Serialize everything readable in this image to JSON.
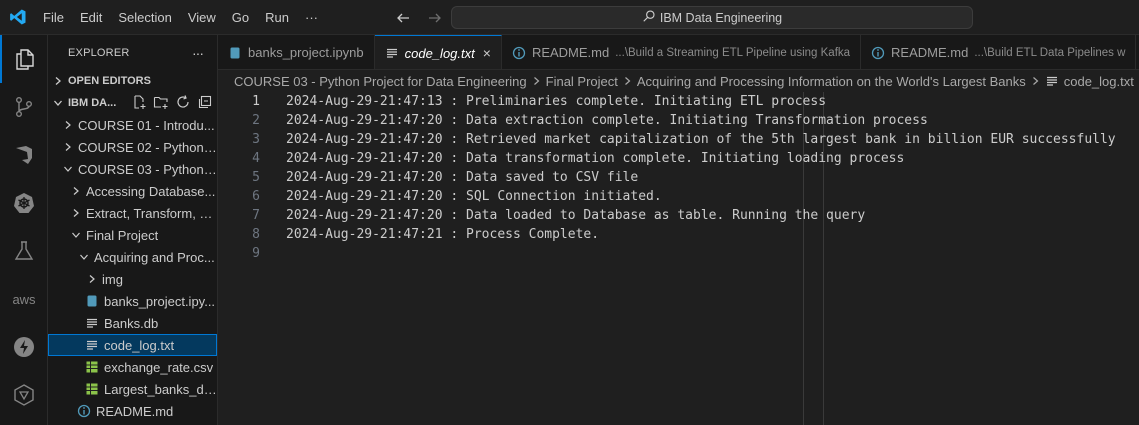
{
  "titlebar": {
    "menu": [
      "File",
      "Edit",
      "Selection",
      "View",
      "Go",
      "Run",
      "···"
    ],
    "search_text": "IBM Data Engineering"
  },
  "activity_bar": {
    "icons": [
      "explorer-icon",
      "source-control-icon",
      "azure-icon",
      "kubernetes-icon",
      "testing-icon",
      "aws-icon",
      "lightning-icon",
      "extension-icon"
    ],
    "aws_label": "aws"
  },
  "sidebar": {
    "title": "EXPLORER",
    "more": "···",
    "open_editors": "OPEN EDITORS",
    "workspace": "IBM DA...",
    "tree": [
      {
        "label": "COURSE 01 - Introdu...",
        "type": "folder",
        "expanded": false,
        "depth": 1
      },
      {
        "label": "COURSE 02 - Python ...",
        "type": "folder",
        "expanded": false,
        "depth": 1
      },
      {
        "label": "COURSE 03 - Python ...",
        "type": "folder",
        "expanded": true,
        "depth": 1
      },
      {
        "label": "Accessing Database...",
        "type": "folder",
        "expanded": false,
        "depth": 2
      },
      {
        "label": "Extract, Transform, a...",
        "type": "folder",
        "expanded": false,
        "depth": 2
      },
      {
        "label": "Final Project",
        "type": "folder",
        "expanded": true,
        "depth": 2
      },
      {
        "label": "Acquiring and Proc...",
        "type": "folder",
        "expanded": true,
        "depth": 3
      },
      {
        "label": "img",
        "type": "folder",
        "expanded": false,
        "depth": 4
      },
      {
        "label": "banks_project.ipy...",
        "type": "notebook",
        "depth": 4
      },
      {
        "label": "Banks.db",
        "type": "text",
        "depth": 4
      },
      {
        "label": "code_log.txt",
        "type": "text",
        "depth": 4,
        "selected": true
      },
      {
        "label": "exchange_rate.csv",
        "type": "csv",
        "depth": 4
      },
      {
        "label": "Largest_banks_da...",
        "type": "csv",
        "depth": 4
      },
      {
        "label": "README.md",
        "type": "info",
        "depth": 3
      }
    ]
  },
  "tabs": [
    {
      "label": "banks_project.ipynb",
      "desc": "",
      "icon": "notebook",
      "active": false
    },
    {
      "label": "code_log.txt",
      "desc": "",
      "icon": "text",
      "active": true,
      "close": "×"
    },
    {
      "label": "README.md",
      "desc": "...\\Build a Streaming ETL Pipeline using Kafka",
      "icon": "info",
      "active": false
    },
    {
      "label": "README.md",
      "desc": "...\\Build ETL Data Pipelines w",
      "icon": "info",
      "active": false
    }
  ],
  "breadcrumb": [
    "COURSE 03 - Python Project for Data Engineering",
    "Final Project",
    "Acquiring and Processing Information on the World's Largest Banks",
    "code_log.txt"
  ],
  "editor": {
    "active_line": 1,
    "lines": [
      "2024-Aug-29-21:47:13 : Preliminaries complete. Initiating ETL process",
      "2024-Aug-29-21:47:20 : Data extraction complete. Initiating Transformation process",
      "2024-Aug-29-21:47:20 : Retrieved market capitalization of the 5th largest bank in billion EUR successfully",
      "2024-Aug-29-21:47:20 : Data transformation complete. Initiating loading process",
      "2024-Aug-29-21:47:20 : Data saved to CSV file",
      "2024-Aug-29-21:47:20 : SQL Connection initiated.",
      "2024-Aug-29-21:47:20 : Data loaded to Database as table. Running the query",
      "2024-Aug-29-21:47:21 : Process Complete.",
      ""
    ]
  },
  "colors": {
    "accent": "#0078d4",
    "vscode_blue": "#23a9f2",
    "csv_green": "#8bc34a",
    "info_blue": "#519aba"
  }
}
